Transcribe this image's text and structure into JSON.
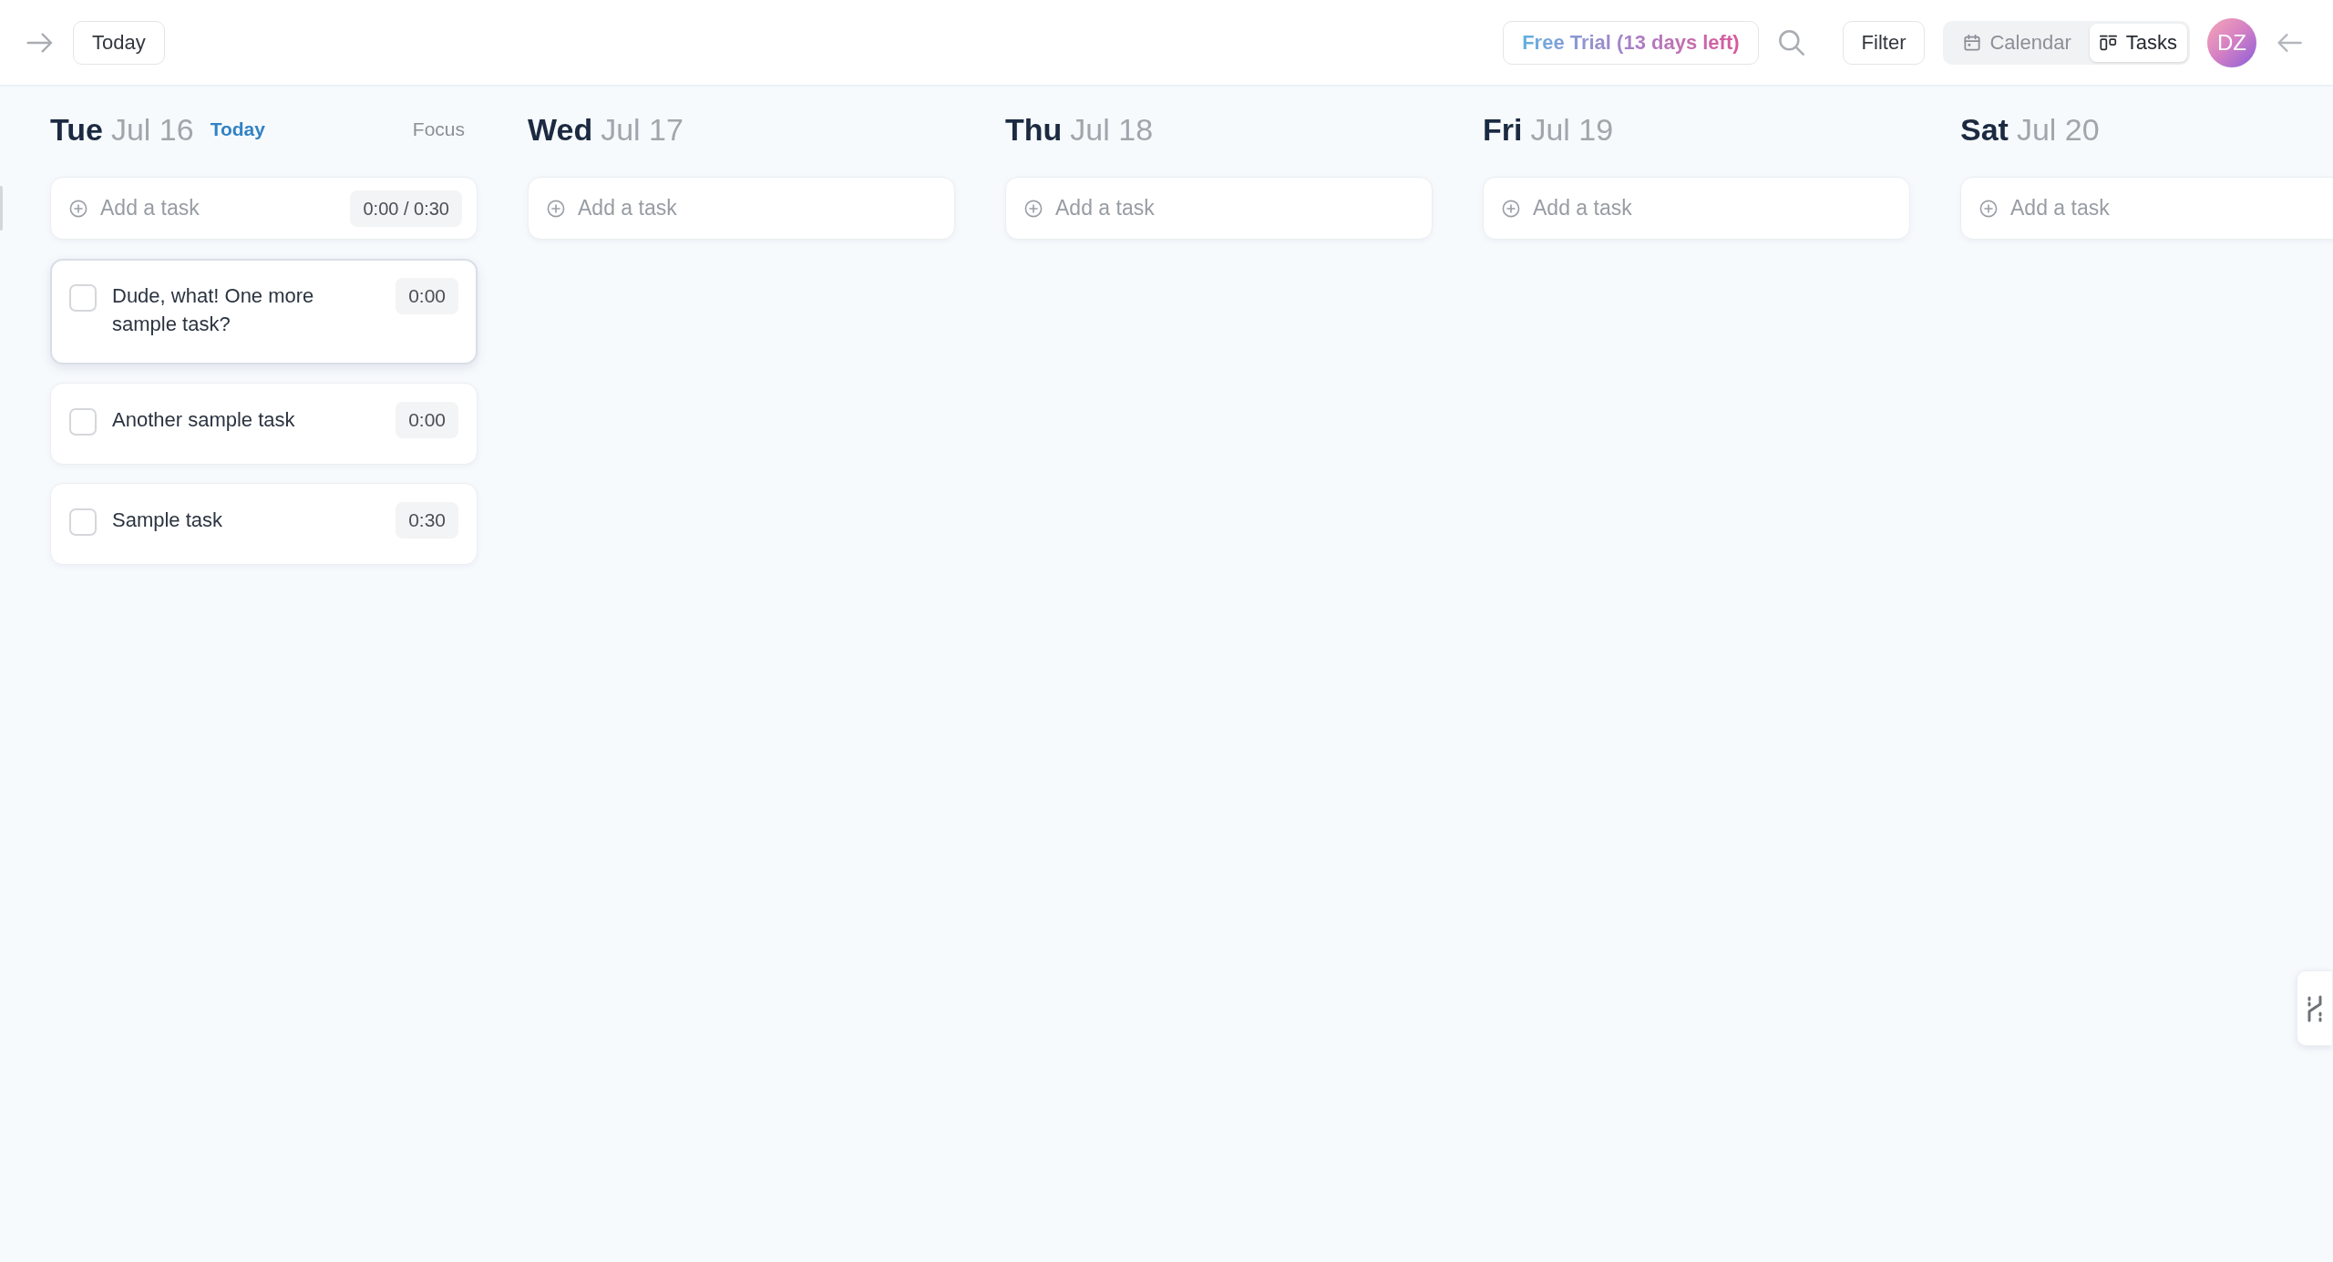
{
  "toolbar": {
    "today_button": "Today",
    "trial_button": "Free Trial (13 days left)",
    "filter_button": "Filter",
    "view_tabs": [
      {
        "label": "Calendar",
        "selected": false
      },
      {
        "label": "Tasks",
        "selected": true
      }
    ],
    "avatar_initials": "DZ"
  },
  "days": [
    {
      "weekday": "Tue",
      "date": "Jul 16",
      "today_label": "Today",
      "focus_button": "Focus",
      "add_task": {
        "placeholder": "Add a task",
        "time_total": "0:00 / 0:30"
      },
      "tasks": [
        {
          "title": "Dude, what! One more sample task?",
          "time": "0:00",
          "checked": false,
          "selected": true
        },
        {
          "title": "Another sample task",
          "time": "0:00",
          "checked": false,
          "selected": false
        },
        {
          "title": "Sample task",
          "time": "0:30",
          "checked": false,
          "selected": false
        }
      ]
    },
    {
      "weekday": "Wed",
      "date": "Jul 17",
      "add_task": {
        "placeholder": "Add a task"
      }
    },
    {
      "weekday": "Thu",
      "date": "Jul 18",
      "add_task": {
        "placeholder": "Add a task"
      }
    },
    {
      "weekday": "Fri",
      "date": "Jul 19",
      "add_task": {
        "placeholder": "Add a task"
      }
    },
    {
      "weekday": "Sat",
      "date": "Jul 20",
      "add_task": {
        "placeholder": "Add a task"
      }
    }
  ]
}
